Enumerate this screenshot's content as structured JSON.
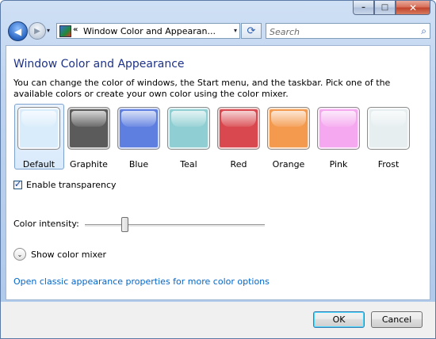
{
  "caption": {
    "minimize_icon": "–",
    "maximize_icon": "□",
    "close_icon": "✕"
  },
  "nav": {
    "back_icon": "◀",
    "forward_icon": "▶",
    "history_icon": "▾",
    "address_chevron": "«",
    "address_text": "Window Color and Appearan...",
    "address_dropdown_icon": "▾",
    "refresh_icon": "⟳",
    "search_placeholder": "Search",
    "search_icon": "⌕"
  },
  "main": {
    "title": "Window Color and Appearance",
    "description": "You can change the color of windows, the Start menu, and the taskbar. Pick one of the available colors or create your own color using the color mixer.",
    "selected_color": "Default",
    "colors": [
      {
        "label": "Default",
        "color": "#d9ecfb"
      },
      {
        "label": "Graphite",
        "color": "#5b5b5b"
      },
      {
        "label": "Blue",
        "color": "#5e7fe0"
      },
      {
        "label": "Teal",
        "color": "#8fcfd3"
      },
      {
        "label": "Red",
        "color": "#d9484e"
      },
      {
        "label": "Orange",
        "color": "#f49a4e"
      },
      {
        "label": "Pink",
        "color": "#f5a8ef"
      },
      {
        "label": "Frost",
        "color": "#e6eef0"
      }
    ],
    "transparency_label": "Enable transparency",
    "transparency_checked": true,
    "intensity_label": "Color intensity:",
    "intensity_level": 0.22,
    "mixer_label": "Show color mixer",
    "mixer_icon": "⌄",
    "classic_link": "Open classic appearance properties for more color options"
  },
  "footer": {
    "ok_label": "OK",
    "cancel_label": "Cancel"
  }
}
